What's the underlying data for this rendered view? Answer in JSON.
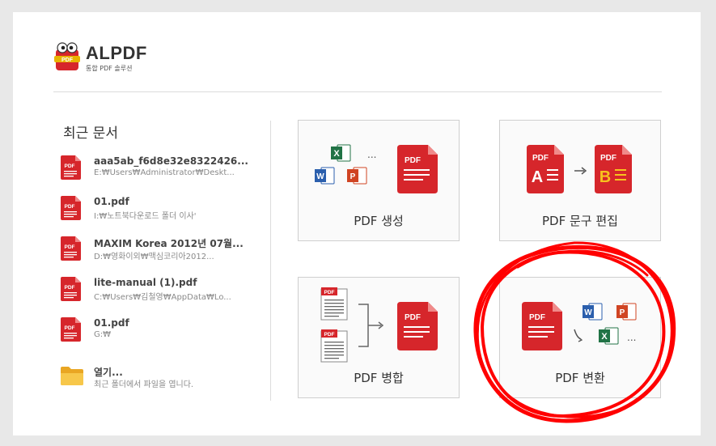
{
  "app": {
    "title": "ALPDF",
    "subtitle": "통합 PDF 솔루션",
    "logo_icon": "pdf-mascot-icon"
  },
  "recent": {
    "heading": "최근 문서",
    "items": [
      {
        "name": "aaa5ab_f6d8e32e8322426...",
        "path": "E:₩Users₩Administrator₩Deskt...",
        "icon": "pdf-file-icon"
      },
      {
        "name": "01.pdf",
        "path": "I:₩노트북다운로드 폴더 이사'",
        "icon": "pdf-file-icon"
      },
      {
        "name": "MAXIM Korea 2012년 07월...",
        "path": "D:₩영화이외₩맥심코리아2012...",
        "icon": "pdf-file-icon"
      },
      {
        "name": "lite-manual (1).pdf",
        "path": "C:₩Users₩김철영₩AppData₩Lo...",
        "icon": "pdf-file-icon"
      },
      {
        "name": "01.pdf",
        "path": "G:₩",
        "icon": "pdf-file-icon"
      }
    ],
    "open": {
      "label": "열기...",
      "desc": "최근 폴더에서 파일을 엽니다.",
      "icon": "folder-icon"
    }
  },
  "tiles": {
    "create": {
      "label": "PDF 생성",
      "icon_text": "PDF",
      "ellipsis": "..."
    },
    "edit": {
      "label": "PDF 문구 편집",
      "icon_text": "PDF",
      "letter_a": "A",
      "letter_b": "B"
    },
    "merge": {
      "label": "PDF 병합",
      "icon_text": "PDF"
    },
    "convert": {
      "label": "PDF 변환",
      "icon_text": "PDF",
      "ellipsis": "..."
    }
  },
  "colors": {
    "pdf_red": "#d6262b",
    "word_blue": "#2b5fad",
    "excel_green": "#217346",
    "ppt_orange": "#d04423",
    "annotation_red": "#ff0000"
  }
}
